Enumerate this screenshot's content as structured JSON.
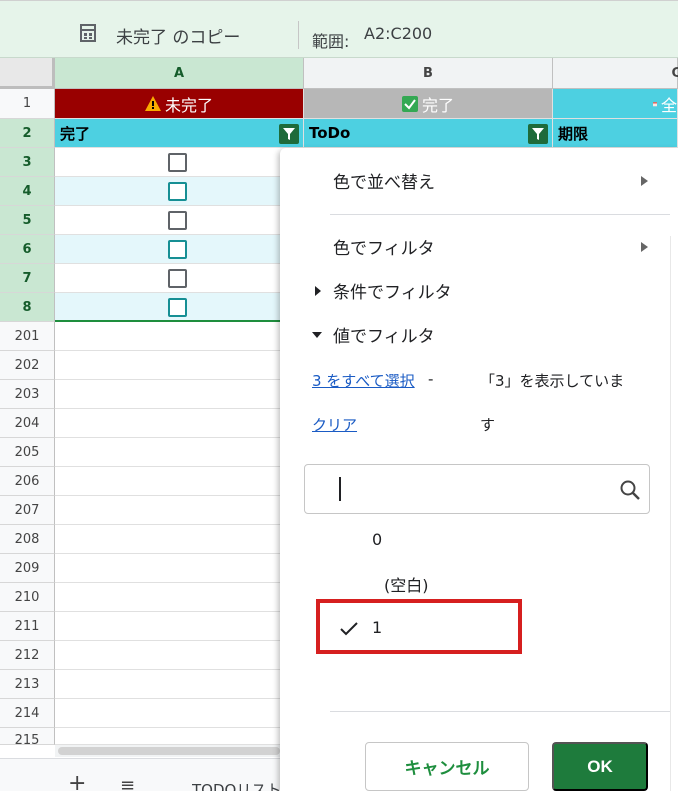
{
  "filter_view": {
    "title": "未完了 のコピー",
    "range_label": "範囲:",
    "range_value": "A2:C200"
  },
  "columns": [
    "A",
    "B",
    "C"
  ],
  "row_numbers": [
    "1",
    "2",
    "3",
    "4",
    "5",
    "6",
    "7",
    "8",
    "201",
    "202",
    "203",
    "204",
    "205",
    "206",
    "207",
    "208",
    "209",
    "210",
    "211",
    "212",
    "213",
    "214",
    "215"
  ],
  "row1": {
    "a": "未完了",
    "b": "完了",
    "c": "全"
  },
  "row2": {
    "a": "完了",
    "b": "ToDo",
    "c": "期限"
  },
  "colors": {
    "accent_green": "#1e7b3c",
    "header_teal": "#4dd0e1",
    "incomplete_red": "#990000",
    "complete_gray": "#b7b7b7",
    "highlight_red": "#d61f1f",
    "link_blue": "#1a5bc4"
  },
  "icons": {
    "filter_view": "filter-view-icon",
    "warning": "warning-icon",
    "checked_box": "checked-box-icon",
    "calendar": "calendar-icon",
    "filter": "filter-icon",
    "search": "search-icon",
    "check": "check-icon"
  },
  "filter_menu": {
    "sort_by_color": "色で並べ替え",
    "filter_by_color": "色でフィルタ",
    "filter_by_condition": "条件でフィルタ",
    "filter_by_values": "値でフィルタ",
    "select_all": "3 をすべて選択",
    "select_all_dash": "-",
    "clear": "クリア",
    "showing_note_line1": "「3」を表示していま",
    "showing_note_line2": "す",
    "search_placeholder": "",
    "values": [
      {
        "label": "0",
        "checked": false
      },
      {
        "label": "(空白)",
        "checked": false
      },
      {
        "label": "1",
        "checked": true
      }
    ],
    "cancel": "キャンセル",
    "ok": "OK"
  },
  "bottom_bar": {
    "add": "+",
    "menu": "≡",
    "sheet_name": "TODOリスト"
  }
}
